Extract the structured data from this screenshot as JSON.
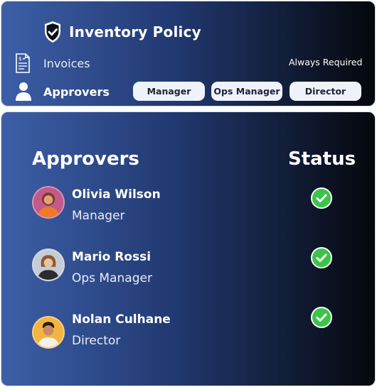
{
  "policy": {
    "title": "Inventory Policy",
    "icon": "shield-check-icon"
  },
  "rules": {
    "invoices_label": "Invoices",
    "invoices_requirement": "Always Required",
    "approvers_label": "Approvers",
    "approver_chips": [
      "Manager",
      "Ops Manager",
      "Director"
    ]
  },
  "table": {
    "headers": {
      "approvers": "Approvers",
      "status": "Status"
    },
    "rows": [
      {
        "name": "Olivia Wilson",
        "role": "Manager",
        "status": "approved"
      },
      {
        "name": "Mario Rossi",
        "role": "Ops Manager",
        "status": "approved"
      },
      {
        "name": "Nolan Culhane",
        "role": "Director",
        "status": "approved"
      }
    ]
  },
  "colors": {
    "gradient_start": "#3d5fa7",
    "gradient_end": "#05070c",
    "check_green": "#3cc34a",
    "chip_bg": "#eef2fb"
  }
}
